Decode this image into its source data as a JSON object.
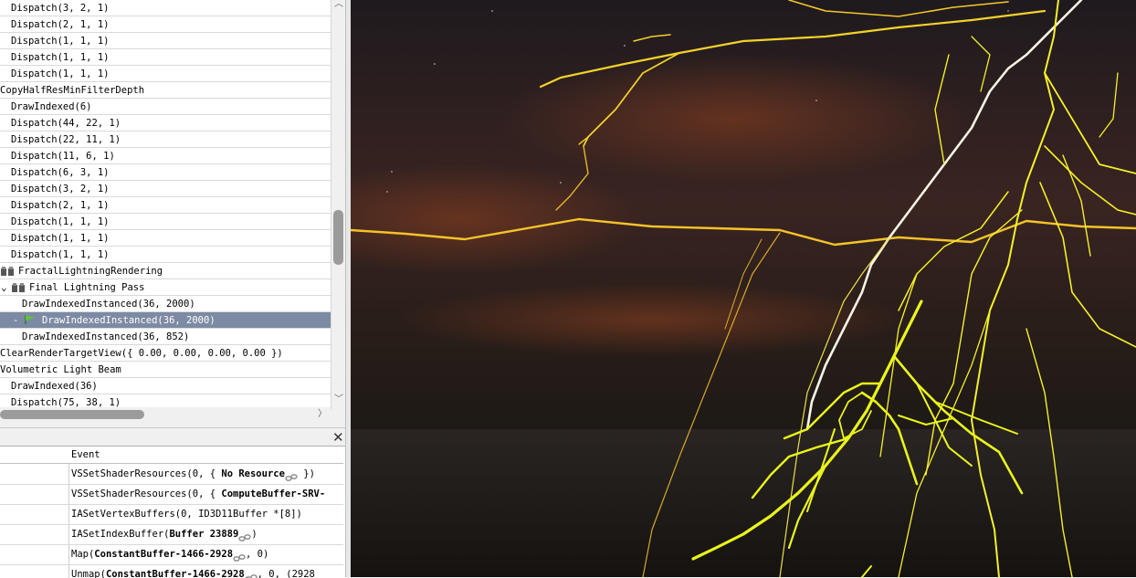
{
  "event_tree": [
    {
      "label": "Dispatch(3, 2, 1)",
      "indent": 12
    },
    {
      "label": "Dispatch(2, 1, 1)",
      "indent": 12
    },
    {
      "label": "Dispatch(1, 1, 1)",
      "indent": 12
    },
    {
      "label": "Dispatch(1, 1, 1)",
      "indent": 12
    },
    {
      "label": "Dispatch(1, 1, 1)",
      "indent": 12
    },
    {
      "label": "CopyHalfResMinFilterDepth",
      "indent": 0
    },
    {
      "label": "DrawIndexed(6)",
      "indent": 12
    },
    {
      "label": "Dispatch(44, 22, 1)",
      "indent": 12
    },
    {
      "label": "Dispatch(22, 11, 1)",
      "indent": 12
    },
    {
      "label": "Dispatch(11, 6, 1)",
      "indent": 12
    },
    {
      "label": "Dispatch(6, 3, 1)",
      "indent": 12
    },
    {
      "label": "Dispatch(3, 2, 1)",
      "indent": 12
    },
    {
      "label": "Dispatch(2, 1, 1)",
      "indent": 12
    },
    {
      "label": "Dispatch(1, 1, 1)",
      "indent": 12
    },
    {
      "label": "Dispatch(1, 1, 1)",
      "indent": 12
    },
    {
      "label": "Dispatch(1, 1, 1)",
      "indent": 12
    },
    {
      "label": "FractalLightningRendering",
      "indent": 20,
      "icon": "marker-group-icon"
    },
    {
      "label": "Final Lightning Pass",
      "indent": 32,
      "icon": "marker-group-icon",
      "expanded": true
    },
    {
      "label": "DrawIndexedInstanced(36, 2000)",
      "indent": 24
    },
    {
      "label": "DrawIndexedInstanced(36, 2000)",
      "indent": 46,
      "selected": true,
      "icon": "current-event-flag-icon"
    },
    {
      "label": "DrawIndexedInstanced(36, 852)",
      "indent": 24
    },
    {
      "label": "ClearRenderTargetView({ 0.00, 0.00, 0.00, 0.00 })",
      "indent": 0
    },
    {
      "label": "Volumetric Light Beam",
      "indent": 0
    },
    {
      "label": "DrawIndexed(36)",
      "indent": 12
    },
    {
      "label": "Dispatch(75, 38, 1)",
      "indent": 12
    }
  ],
  "api_panel": {
    "column_header": "Event",
    "rows": [
      {
        "pre": "VSSetShaderResources(0,  {  ",
        "bold": "No Resource",
        "post": "  })",
        "link": true
      },
      {
        "pre": "VSSetShaderResources(0,  {  ",
        "bold": "ComputeBuffer-SRV-",
        "post": "",
        "link": false
      },
      {
        "pre": "IASetVertexBuffers(0, ID3D11Buffer *[8])",
        "bold": "",
        "post": "",
        "link": false
      },
      {
        "pre": "IASetIndexBuffer(",
        "bold": "Buffer 23889",
        "post": ")",
        "link": true
      },
      {
        "pre": "Map(",
        "bold": "ConstantBuffer-1466-2928",
        "post": ",  0)",
        "link": true
      },
      {
        "pre": "Unmap(",
        "bold": "ConstantBuffer-1466-2928",
        "post": ",  0,  (2928",
        "link": true
      }
    ]
  },
  "icons": {
    "close": "close-icon",
    "scroll_up": "chevron-up-icon",
    "scroll_down": "chevron-down-icon",
    "scroll_right": "chevron-right-icon",
    "expand": "expand-chevron-icon"
  },
  "symbols": {
    "close": "✕",
    "up": "︿",
    "down": "﹀",
    "right": "〉",
    "expand": "⌄"
  },
  "colors": {
    "selection": "#7d8aa3",
    "bolt_yellow": "#f4f02a",
    "bolt_white": "#f7f5e6",
    "sky_dark": "#1a1515"
  }
}
